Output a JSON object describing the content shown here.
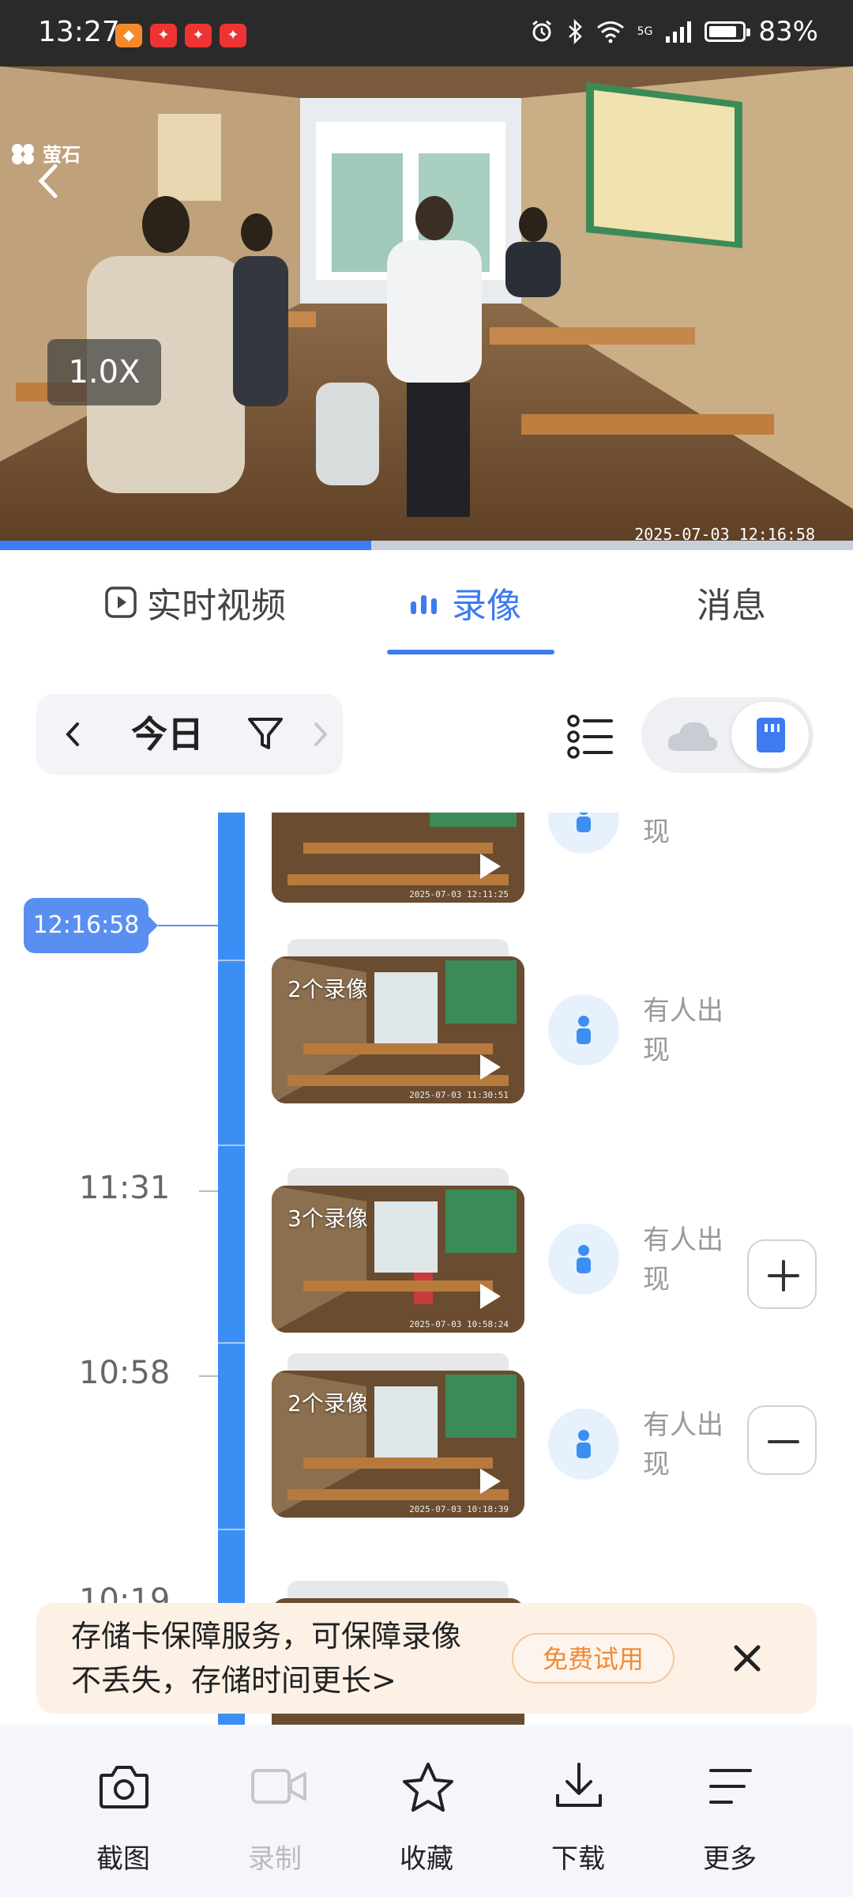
{
  "status_bar": {
    "time": "13:27",
    "network": "5G",
    "battery": "83%",
    "battery_level": 0.83
  },
  "player": {
    "brand": "萤石",
    "zoom": "1.0X",
    "timestamp": "2025-07-03 12:16:58",
    "progress": 0.435
  },
  "tabs": [
    {
      "label": "实时视频"
    },
    {
      "label": "录像"
    },
    {
      "label": "消息"
    }
  ],
  "filter": {
    "date_label": "今日"
  },
  "timeline": {
    "current_marker": "12:16:58",
    "times": [
      "11:31",
      "10:58",
      "10:19"
    ],
    "clips": [
      {
        "count": "",
        "timestamp": "2025-07-03 12:11:25",
        "event": "现"
      },
      {
        "count": "2个录像",
        "timestamp": "2025-07-03 11:30:51",
        "event": "有人出现"
      },
      {
        "count": "3个录像",
        "timestamp": "2025-07-03 10:58:24",
        "event": "有人出现"
      },
      {
        "count": "2个录像",
        "timestamp": "2025-07-03 10:18:39",
        "event": "有人出现"
      }
    ]
  },
  "banner": {
    "text": "存储卡保障服务，可保障录像不丢失，存储时间更长>",
    "button": "免费试用"
  },
  "toolbar": [
    {
      "label": "截图"
    },
    {
      "label": "录制"
    },
    {
      "label": "收藏"
    },
    {
      "label": "下载"
    },
    {
      "label": "更多"
    }
  ],
  "colors": {
    "accent": "#3c7bf0",
    "timeline": "#3b8ef3",
    "banner_bg": "#fdf1e6",
    "banner_button": "#f08a38"
  }
}
